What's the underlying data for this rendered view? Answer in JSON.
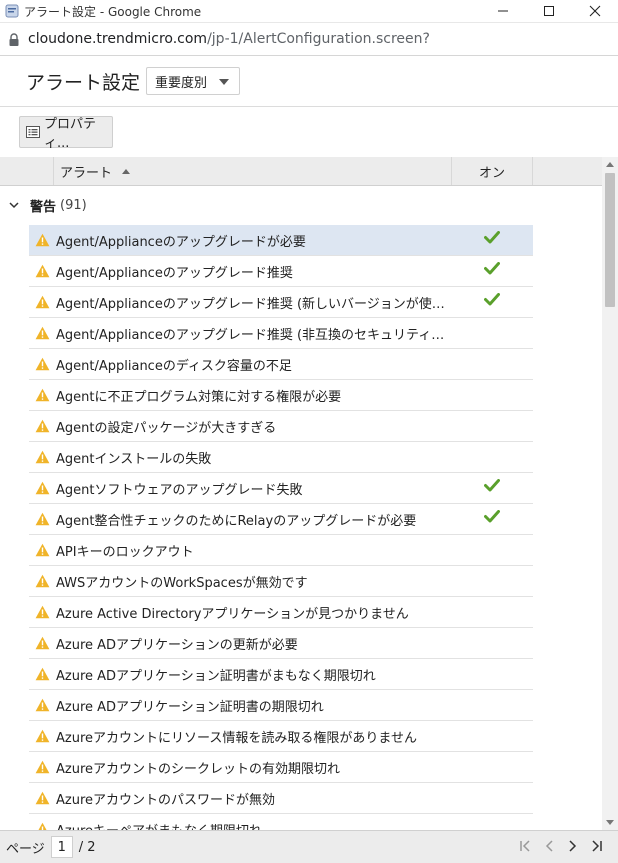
{
  "window": {
    "title": "アラート設定 - Google Chrome",
    "minimize": "—",
    "maximize": "☐",
    "close": "✕"
  },
  "address": {
    "host": "cloudone.trendmicro.com",
    "path": "/jp-1/AlertConfiguration.screen?"
  },
  "header": {
    "title": "アラート設定",
    "view_select": "重要度別"
  },
  "toolbar": {
    "properties_label": "プロパティ..."
  },
  "grid": {
    "columns": {
      "alert": "アラート",
      "on": "オン"
    },
    "group": {
      "name": "警告",
      "count": "(91)"
    },
    "rows": [
      {
        "label": "Agent/Applianceのアップグレードが必要",
        "on": true,
        "selected": true
      },
      {
        "label": "Agent/Applianceのアップグレード推奨",
        "on": true
      },
      {
        "label": "Agent/Applianceのアップグレード推奨 (新しいバージョンが使用可能)",
        "on": true
      },
      {
        "label": "Agent/Applianceのアップグレード推奨 (非互換のセキュリティアップデ…",
        "on": false
      },
      {
        "label": "Agent/Applianceのディスク容量の不足",
        "on": false
      },
      {
        "label": "Agentに不正プログラム対策に対する権限が必要",
        "on": false
      },
      {
        "label": "Agentの設定パッケージが大きすぎる",
        "on": false
      },
      {
        "label": "Agentインストールの失敗",
        "on": false
      },
      {
        "label": "Agentソフトウェアのアップグレード失敗",
        "on": true
      },
      {
        "label": "Agent整合性チェックのためにRelayのアップグレードが必要",
        "on": true
      },
      {
        "label": "APIキーのロックアウト",
        "on": false
      },
      {
        "label": "AWSアカウントのWorkSpacesが無効です",
        "on": false
      },
      {
        "label": "Azure Active Directoryアプリケーションが見つかりません",
        "on": false
      },
      {
        "label": "Azure ADアプリケーションの更新が必要",
        "on": false
      },
      {
        "label": "Azure ADアプリケーション証明書がまもなく期限切れ",
        "on": false
      },
      {
        "label": "Azure ADアプリケーション証明書の期限切れ",
        "on": false
      },
      {
        "label": "Azureアカウントにリソース情報を読み取る権限がありません",
        "on": false
      },
      {
        "label": "Azureアカウントのシークレットの有効期限切れ",
        "on": false
      },
      {
        "label": "Azureアカウントのパスワードが無効",
        "on": false
      },
      {
        "label": "Azureキーペアがまもなく期限切れ",
        "on": false
      }
    ]
  },
  "pager": {
    "page_label": "ページ",
    "current": "1",
    "total": "/ 2"
  },
  "colors": {
    "selected_row": "#dde6f2",
    "check": "#5aa02c",
    "warning": "#f0b429"
  }
}
